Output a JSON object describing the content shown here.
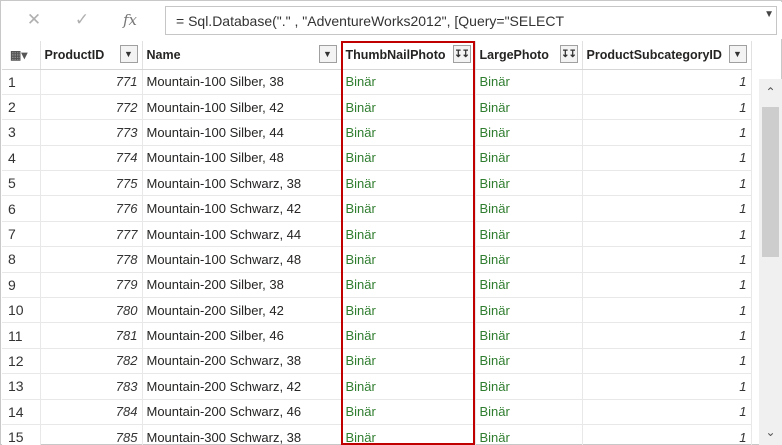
{
  "formula_bar": {
    "cancel_icon": "close-icon",
    "commit_icon": "check-icon",
    "fx_label": "fx",
    "formula": "= Sql.Database(\".\" , \"AdventureWorks2012\", [Query=\"SELECT"
  },
  "table": {
    "columns": [
      {
        "label": "ProductID",
        "button": "filter"
      },
      {
        "label": "Name",
        "button": "filter"
      },
      {
        "label": "ThumbNailPhoto",
        "button": "expand"
      },
      {
        "label": "LargePhoto",
        "button": "expand"
      },
      {
        "label": "ProductSubcategoryID",
        "button": "filter"
      }
    ],
    "rows": [
      {
        "n": "1",
        "id": "771",
        "name": "Mountain-100 Silber, 38",
        "thumb": "Binär",
        "large": "Binär",
        "sub": "1"
      },
      {
        "n": "2",
        "id": "772",
        "name": "Mountain-100 Silber, 42",
        "thumb": "Binär",
        "large": "Binär",
        "sub": "1"
      },
      {
        "n": "3",
        "id": "773",
        "name": "Mountain-100 Silber, 44",
        "thumb": "Binär",
        "large": "Binär",
        "sub": "1"
      },
      {
        "n": "4",
        "id": "774",
        "name": "Mountain-100 Silber, 48",
        "thumb": "Binär",
        "large": "Binär",
        "sub": "1"
      },
      {
        "n": "5",
        "id": "775",
        "name": "Mountain-100 Schwarz, 38",
        "thumb": "Binär",
        "large": "Binär",
        "sub": "1"
      },
      {
        "n": "6",
        "id": "776",
        "name": "Mountain-100 Schwarz, 42",
        "thumb": "Binär",
        "large": "Binär",
        "sub": "1"
      },
      {
        "n": "7",
        "id": "777",
        "name": "Mountain-100 Schwarz, 44",
        "thumb": "Binär",
        "large": "Binär",
        "sub": "1"
      },
      {
        "n": "8",
        "id": "778",
        "name": "Mountain-100 Schwarz, 48",
        "thumb": "Binär",
        "large": "Binär",
        "sub": "1"
      },
      {
        "n": "9",
        "id": "779",
        "name": "Mountain-200 Silber, 38",
        "thumb": "Binär",
        "large": "Binär",
        "sub": "1"
      },
      {
        "n": "10",
        "id": "780",
        "name": "Mountain-200 Silber, 42",
        "thumb": "Binär",
        "large": "Binär",
        "sub": "1"
      },
      {
        "n": "11",
        "id": "781",
        "name": "Mountain-200 Silber, 46",
        "thumb": "Binär",
        "large": "Binär",
        "sub": "1"
      },
      {
        "n": "12",
        "id": "782",
        "name": "Mountain-200 Schwarz, 38",
        "thumb": "Binär",
        "large": "Binär",
        "sub": "1"
      },
      {
        "n": "13",
        "id": "783",
        "name": "Mountain-200 Schwarz, 42",
        "thumb": "Binär",
        "large": "Binär",
        "sub": "1"
      },
      {
        "n": "14",
        "id": "784",
        "name": "Mountain-200 Schwarz, 46",
        "thumb": "Binär",
        "large": "Binär",
        "sub": "1"
      },
      {
        "n": "15",
        "id": "785",
        "name": "Mountain-300 Schwarz, 38",
        "thumb": "Binär",
        "large": "Binär",
        "sub": "1"
      }
    ]
  },
  "colors": {
    "binary_text": "#2f7d2f",
    "highlight_border": "#c00000"
  }
}
